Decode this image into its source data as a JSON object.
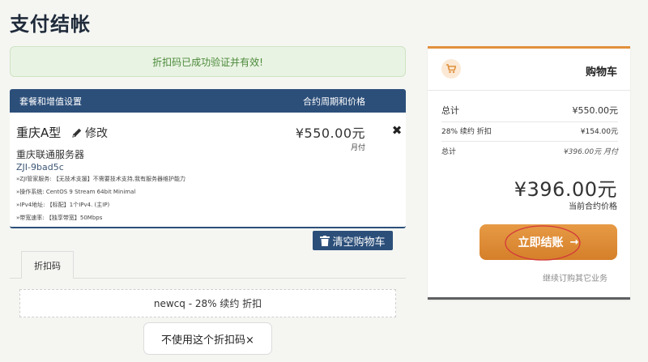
{
  "page": {
    "title": "支付结帐"
  },
  "alert": {
    "message": "折扣码已成功验证并有效!"
  },
  "product_table": {
    "header_left": "套餐和增值设置",
    "header_right": "合约周期和价格",
    "item": {
      "name": "重庆A型",
      "edit_label": "修改",
      "price": "¥550.00元",
      "cycle": "月付",
      "group": "重庆联通服务器",
      "domain": "ZJI-9bad5c",
      "specs": [
        "»ZJI管家服务: 【无技术支援】不需要技术支持,我有服务器维护能力",
        "»操作系统: CentOS 9 Stream 64bit Minimal",
        "»IPv4地址: 【标配】1个IPv4. (主IP)",
        "»带宽速率: 【独享带宽】50Mbps"
      ]
    },
    "empty_cart_label": "清空购物车"
  },
  "promo": {
    "tab_label": "折扣码",
    "applied_text": "newcq - 28% 续约 折扣",
    "remove_label": "不使用这个折扣码×"
  },
  "cart": {
    "title": "购物车",
    "subtotal_label": "总计",
    "subtotal_value": "¥550.00元",
    "discount_label": "28% 续约 折扣",
    "discount_value": "¥154.00元",
    "recurring_label": "总计",
    "recurring_value": "¥396.00元 月付",
    "total_value": "¥396.00元",
    "total_label": "当前合约价格",
    "checkout_label": "立即结账",
    "checkout_arrow": "→",
    "continue_label": "继续订购其它业务"
  },
  "colors": {
    "primary": "#2c4f7a",
    "accent": "#e0913c",
    "success_bg": "#e9f3e3",
    "success_text": "#4b8a3a",
    "annotation_ring": "#d23a3a"
  },
  "icons": {
    "edit": "pencil-icon",
    "remove": "close-icon",
    "empty_cart": "trash-icon",
    "cart": "cart-icon"
  }
}
